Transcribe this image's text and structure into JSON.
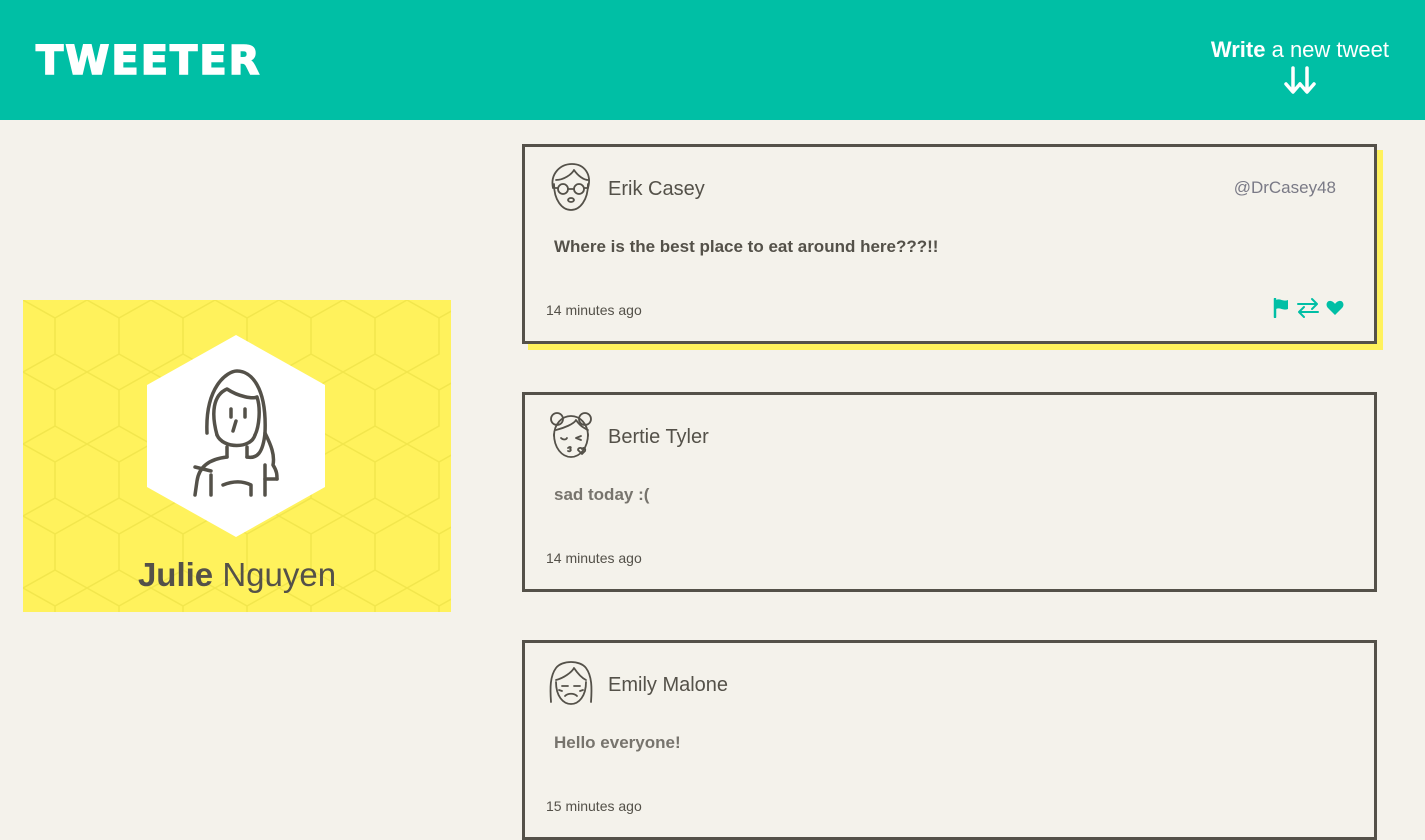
{
  "app": {
    "logo": "TWEETER"
  },
  "nav": {
    "compose_strong": "Write",
    "compose_rest": " a new tweet",
    "compose_icon": "double-arrow-down-icon"
  },
  "colors": {
    "header": "#00bfa5",
    "background": "#f4f2eb",
    "profile_bg": "#fff25c",
    "text": "#545149",
    "accent": "#00bfa5"
  },
  "profile": {
    "first_name": "Julie",
    "last_name": "Nguyen",
    "avatar_icon": "woman-avatar-icon"
  },
  "tweets": [
    {
      "name": "Erik Casey",
      "handle": "@DrCasey48",
      "text": "Where is the best place to eat around here???!!",
      "time": "14 minutes ago",
      "avatar_icon": "man-glasses-avatar-icon",
      "actions": [
        "flag-icon",
        "retweet-icon",
        "heart-icon"
      ]
    },
    {
      "name": "Bertie Tyler",
      "text": "sad today :(",
      "time": "14 minutes ago",
      "avatar_icon": "girl-kiss-avatar-icon"
    },
    {
      "name": "Emily Malone",
      "text": "Hello everyone!",
      "time": "15 minutes ago",
      "avatar_icon": "woman-sad-avatar-icon"
    }
  ]
}
